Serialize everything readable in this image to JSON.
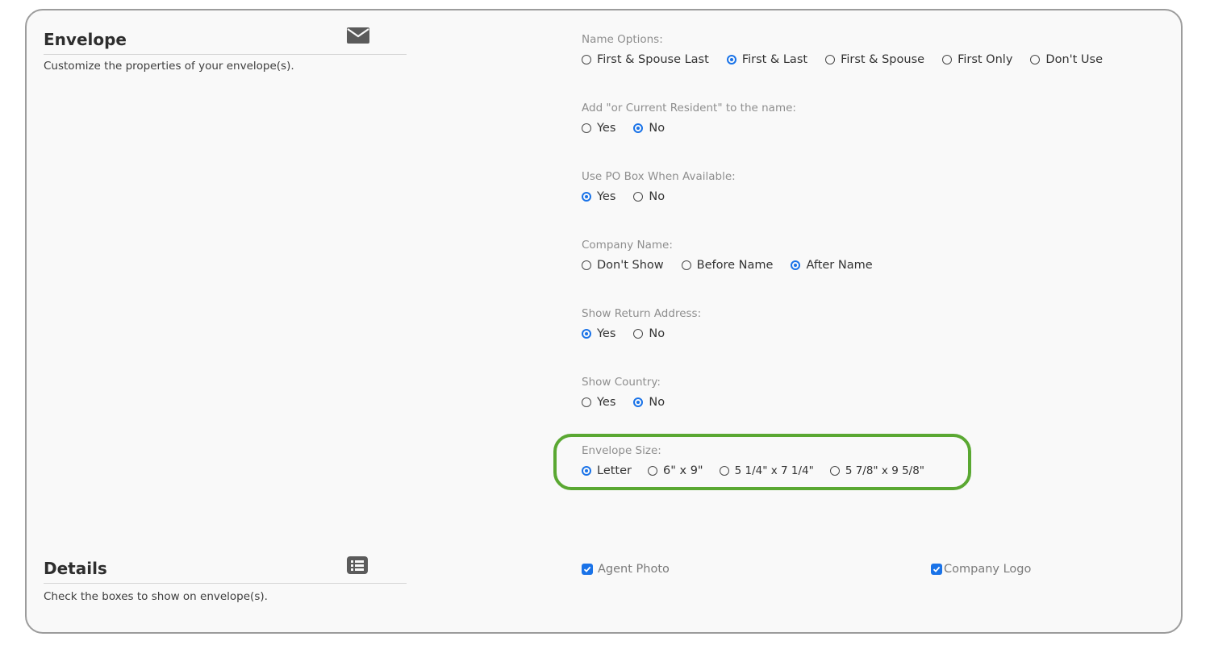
{
  "envelope": {
    "title": "Envelope",
    "description": "Customize the properties of your envelope(s).",
    "icon": "envelope-icon"
  },
  "details": {
    "title": "Details",
    "description": "Check the boxes to show on envelope(s).",
    "icon": "list-icon"
  },
  "groups": [
    {
      "label": "Name Options:",
      "options": [
        "First & Spouse Last",
        "First & Last",
        "First & Spouse",
        "First Only",
        "Don't Use"
      ],
      "selected": 1
    },
    {
      "label": "Add \"or Current Resident\" to the name:",
      "options": [
        "Yes",
        "No"
      ],
      "selected": 1
    },
    {
      "label": "Use PO Box When Available:",
      "options": [
        "Yes",
        "No"
      ],
      "selected": 0
    },
    {
      "label": "Company Name:",
      "options": [
        "Don't Show",
        "Before Name",
        "After Name"
      ],
      "selected": 2
    },
    {
      "label": "Show Return Address:",
      "options": [
        "Yes",
        "No"
      ],
      "selected": 0
    },
    {
      "label": "Show Country:",
      "options": [
        "Yes",
        "No"
      ],
      "selected": 1
    },
    {
      "label": "Envelope Size:",
      "options": [
        "Letter",
        "6\" x 9\"",
        "5 1/4\" x 7 1/4\"",
        "5 7/8\" x 9 5/8\""
      ],
      "selected": 0
    }
  ],
  "checkboxes": [
    {
      "label": "Agent Photo",
      "checked": true
    },
    {
      "label": "Company Logo",
      "checked": true
    }
  ],
  "colors": {
    "accent": "#1a73e8",
    "highlight": "#5aa832"
  }
}
